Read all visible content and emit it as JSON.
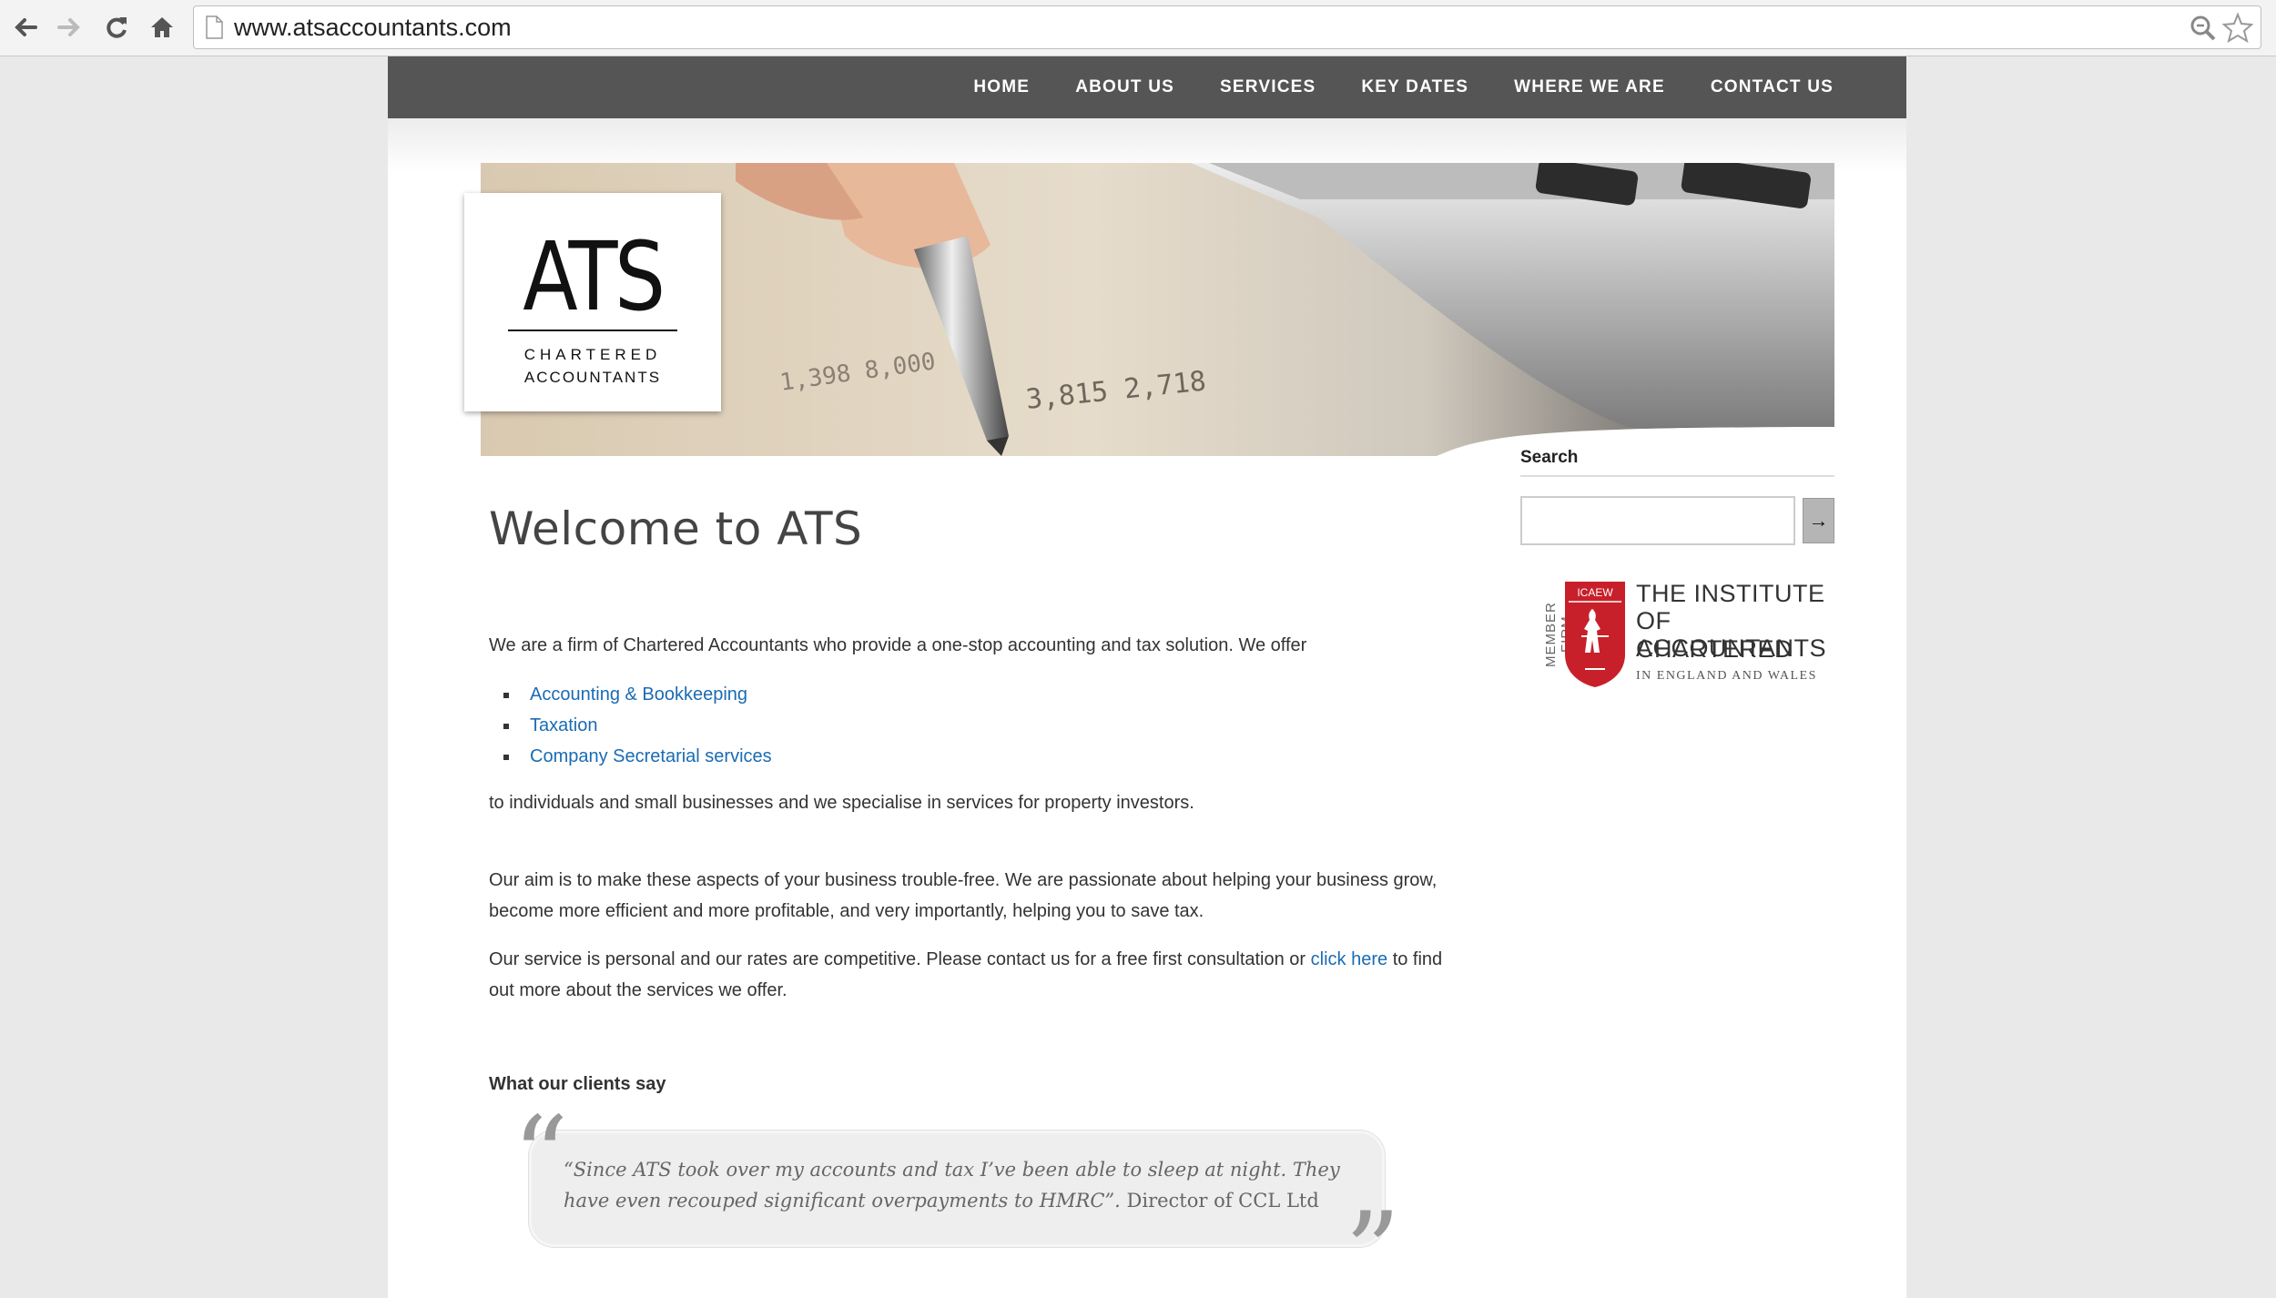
{
  "browser": {
    "url": "www.atsaccountants.com"
  },
  "nav": {
    "items": [
      "HOME",
      "ABOUT US",
      "SERVICES",
      "KEY DATES",
      "WHERE WE ARE",
      "CONTACT US"
    ]
  },
  "logo": {
    "main": "ATS",
    "line1": "CHARTERED",
    "line2": "ACCOUNTANTS"
  },
  "content": {
    "title": "Welcome to ATS",
    "intro": "We are a firm of Chartered Accountants who provide a one-stop accounting and tax solution. We offer",
    "services": [
      "Accounting & Bookkeeping",
      "Taxation",
      "Company Secretarial services"
    ],
    "after_list": "to individuals and small businesses and we specialise in services for property investors.",
    "aim": "Our aim is to make these aspects of your business trouble-free. We are passionate about helping your business grow, become more efficient and more profitable, and very importantly, helping you to save tax.",
    "service_pre": "Our service is personal and our rates are competitive.  Please contact us for a free first consultation or ",
    "service_link": "click here",
    "service_post": " to find out more about the services we offer.",
    "clients_heading": "What our clients say",
    "quote": "“Since ATS took over my accounts and tax I’ve been able to sleep at night.  They have even recouped significant overpayments to HMRC”.",
    "quote_author": " Director of CCL Ltd"
  },
  "sidebar": {
    "search_heading": "Search",
    "search_button": "→",
    "icaew": {
      "side": "MEMBER FIRM",
      "badge": "ICAEW",
      "line1": "THE INSTITUTE",
      "line2": "OF CHARTERED",
      "line3": "ACCOUNTANTS",
      "line4": "IN ENGLAND AND WALES"
    }
  }
}
